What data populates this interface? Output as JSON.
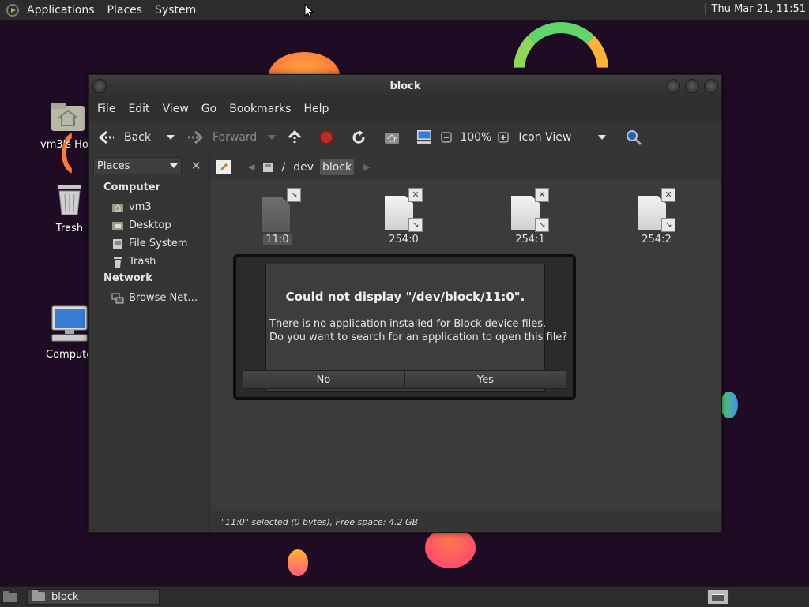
{
  "top_panel": {
    "menus": [
      "Applications",
      "Places",
      "System"
    ],
    "clock": "Thu Mar 21, 11:51"
  },
  "desktop": {
    "icons": [
      {
        "label": "vm3's Home",
        "icon": "home-folder-icon"
      },
      {
        "label": "Trash",
        "icon": "trash-icon"
      },
      {
        "label": "Computer",
        "icon": "computer-icon"
      }
    ]
  },
  "window": {
    "title": "block",
    "menubar": [
      "File",
      "Edit",
      "View",
      "Go",
      "Bookmarks",
      "Help"
    ],
    "toolbar": {
      "back": "Back",
      "forward": "Forward",
      "zoom": "100%",
      "view_mode": "Icon View"
    },
    "sidebar": {
      "selector": "Places",
      "groups": [
        {
          "heading": "Computer",
          "items": [
            "vm3",
            "Desktop",
            "File System",
            "Trash"
          ]
        },
        {
          "heading": "Network",
          "items": [
            "Browse Net…"
          ]
        }
      ]
    },
    "path": [
      "/",
      "dev",
      "block"
    ],
    "files": [
      {
        "name": "11:0",
        "selected": true
      },
      {
        "name": "254:0"
      },
      {
        "name": "254:1"
      },
      {
        "name": "254:2"
      }
    ],
    "status": "\"11:0\" selected (0 bytes), Free space: 4.2 GB"
  },
  "dialog": {
    "title": "Could not display \"/dev/block/11:0\".",
    "message": "There is no application installed for Block device files.\nDo you want to search for an application to open this file?",
    "buttons": {
      "no": "No",
      "yes": "Yes"
    }
  },
  "bottom_panel": {
    "task": "block"
  },
  "colors": {
    "desktop_bg": "#200b24",
    "panel_bg": "#2c2c2c",
    "window_bg": "#3b3b3b",
    "stop_red": "#c0392b"
  }
}
